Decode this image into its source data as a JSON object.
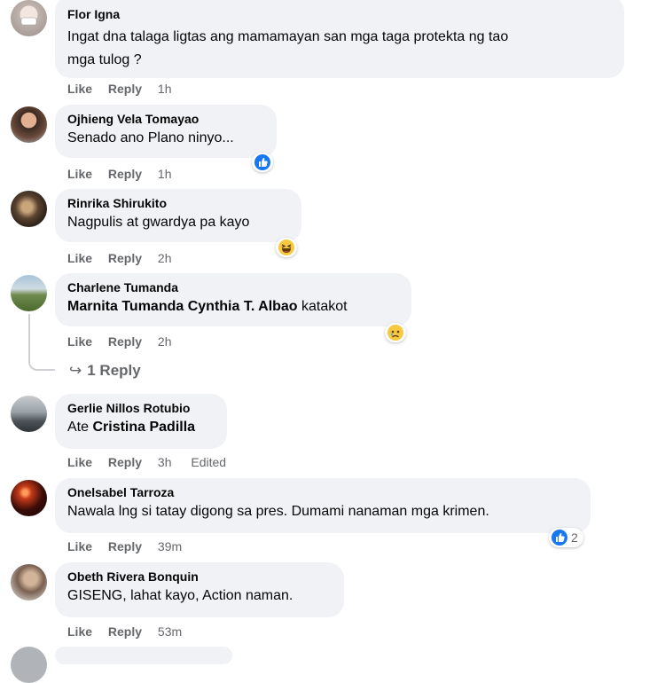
{
  "actions": {
    "like": "Like",
    "reply": "Reply"
  },
  "comments": [
    {
      "author": "Flor Igna",
      "text": "Ingat dna talaga ligtas ang mamamayan san mga taga protekta ng tao",
      "text2": "mga tulog ?",
      "time": "1h"
    },
    {
      "author": "Ojhieng Vela Tomayao",
      "text": "Senado ano Plano ninyo...",
      "time": "1h",
      "reaction": "like-icon"
    },
    {
      "author": "Rinrika Shirukito",
      "text": "Nagpulis at gwardya pa kayo",
      "time": "2h",
      "reaction": "haha-icon"
    },
    {
      "author": "Charlene Tumanda",
      "mention": "Marnita Tumanda Cynthia T. Albao",
      "text": " katakot",
      "time": "2h",
      "reaction": "sad-icon",
      "replies_label": "1 Reply"
    },
    {
      "author": "Gerlie Nillos Rotubio",
      "text": "Ate ",
      "mention": "Cristina Padilla",
      "time": "3h",
      "edited": "Edited"
    },
    {
      "author": "Onelsabel Tarroza",
      "text": "Nawala lng si tatay digong sa pres. Dumami nanaman mga krimen.",
      "time": "39m",
      "reaction": "like-icon",
      "reaction_count": "2"
    },
    {
      "author": "Obeth Rivera Bonquin",
      "text": "GISENG, lahat kayo, Action naman.",
      "time": "53m"
    }
  ],
  "colors": {
    "bubble": "#f0f2f5",
    "meta": "#65676b",
    "like_blue": "#1877f2"
  }
}
